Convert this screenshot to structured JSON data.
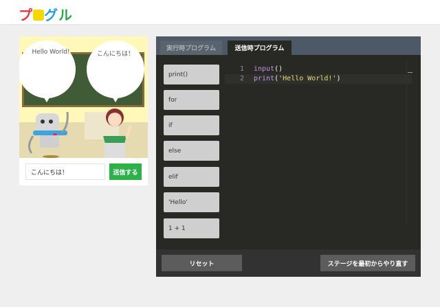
{
  "header": {
    "logo": "プログル"
  },
  "stage": {
    "bubble_left": "Hello World!",
    "bubble_right": "こんにちは！",
    "input_value": "こんにちは！",
    "send_label": "送信する"
  },
  "editor_panel": {
    "tabs": [
      {
        "label": "実行時プログラム",
        "active": false
      },
      {
        "label": "送信時プログラム",
        "active": true
      }
    ],
    "palette": [
      "print()",
      "for",
      "if",
      "else",
      "elif",
      "'Hello'",
      "1 + 1"
    ],
    "code_lines": [
      {
        "num": "1",
        "fn": "input",
        "open": "(",
        "arg": "",
        "close": ")"
      },
      {
        "num": "2",
        "fn": "print",
        "open": "(",
        "arg": "'Hello World!'",
        "close": ")"
      }
    ],
    "reset_label": "リセット",
    "restart_label": "ステージを最初からやり直す"
  }
}
